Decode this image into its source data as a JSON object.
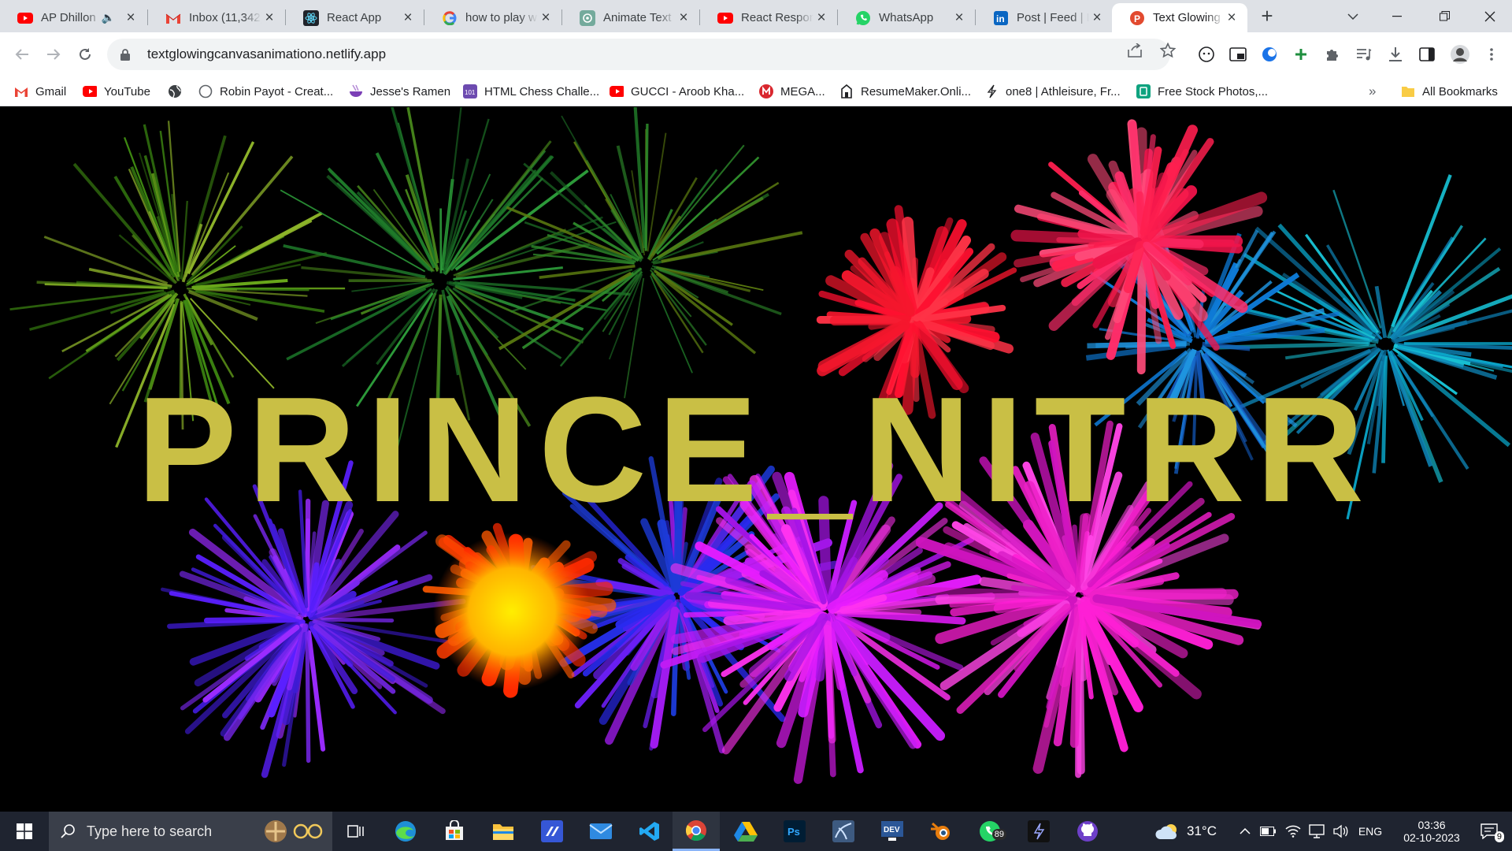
{
  "browser": {
    "tabs": [
      {
        "title": "AP Dhillon",
        "icon": "youtube-icon",
        "audio": true
      },
      {
        "title": "Inbox (11,342)",
        "icon": "gmail-icon"
      },
      {
        "title": "React App",
        "icon": "react-icon"
      },
      {
        "title": "how to play w",
        "icon": "google-icon"
      },
      {
        "title": "Animate Text",
        "icon": "chatgpt-icon"
      },
      {
        "title": "React Respon",
        "icon": "youtube-icon"
      },
      {
        "title": "WhatsApp",
        "icon": "whatsapp-icon"
      },
      {
        "title": "Post | Feed | L",
        "icon": "linkedin-icon"
      },
      {
        "title": "Text Glowing",
        "icon": "page-icon",
        "active": true
      }
    ],
    "new_tab_label": "+",
    "url": "textglowingcanvasanimationo.netlify.app",
    "bookmarks": [
      {
        "label": "Gmail",
        "icon": "gmail-icon"
      },
      {
        "label": "YouTube",
        "icon": "youtube-icon"
      },
      {
        "label": "",
        "icon": "globe-icon"
      },
      {
        "label": "Robin Payot - Creat...",
        "icon": "circle-icon"
      },
      {
        "label": "Jesse's Ramen",
        "icon": "ramen-icon"
      },
      {
        "label": "HTML Chess Challe...",
        "icon": "chess-icon"
      },
      {
        "label": "GUCCI - Aroob Kha...",
        "icon": "youtube-icon"
      },
      {
        "label": "MEGA...",
        "icon": "mega-icon"
      },
      {
        "label": "ResumeMaker.Onli...",
        "icon": "resume-icon"
      },
      {
        "label": "one8 | Athleisure, Fr...",
        "icon": "one8-icon"
      },
      {
        "label": "Free Stock Photos,...",
        "icon": "photo-icon"
      }
    ],
    "bookmarks_overflow": "»",
    "all_bookmarks": "All Bookmarks"
  },
  "page": {
    "headline": "PRINCE_NITRR",
    "headline_color": "#c9bf45"
  },
  "taskbar": {
    "search_placeholder": "Type here to search",
    "whatsapp_badge": "89",
    "weather": "31°C",
    "language": "ENG",
    "time": "03:36",
    "date": "02-10-2023",
    "notifications": "9"
  }
}
